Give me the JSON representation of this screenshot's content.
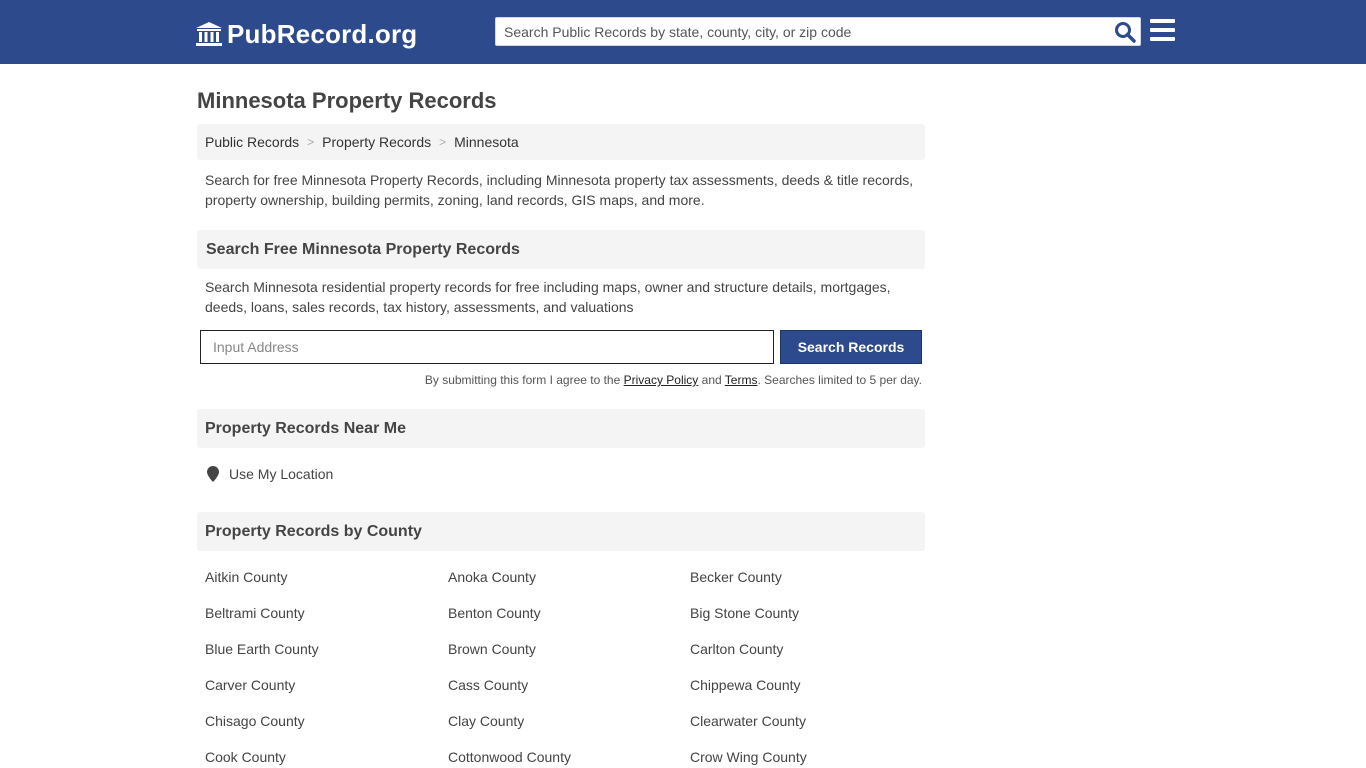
{
  "header": {
    "logo_text": "PubRecord.org",
    "search_placeholder": "Search Public Records by state, county, city, or zip code"
  },
  "page": {
    "title": "Minnesota Property Records",
    "breadcrumb": [
      "Public Records",
      "Property Records",
      "Minnesota"
    ],
    "intro": "Search for free Minnesota Property Records, including Minnesota property tax assessments, deeds & title records, property ownership, building permits, zoning, land records, GIS maps, and more."
  },
  "search_section": {
    "heading": "Search Free Minnesota Property Records",
    "description": "Search Minnesota residential property records for free including maps, owner and structure details, mortgages, deeds, loans, sales records, tax history, assessments, and valuations",
    "input_placeholder": "Input Address",
    "button_label": "Search Records",
    "disclaimer_prefix": "By submitting this form I agree to the ",
    "privacy_label": "Privacy Policy",
    "and_text": " and ",
    "terms_label": "Terms",
    "disclaimer_suffix": ". Searches limited to 5 per day."
  },
  "near_me": {
    "heading": "Property Records Near Me",
    "location_label": "Use My Location"
  },
  "by_county": {
    "heading": "Property Records by County",
    "counties": [
      "Aitkin County",
      "Anoka County",
      "Becker County",
      "Beltrami County",
      "Benton County",
      "Big Stone County",
      "Blue Earth County",
      "Brown County",
      "Carlton County",
      "Carver County",
      "Cass County",
      "Chippewa County",
      "Chisago County",
      "Clay County",
      "Clearwater County",
      "Cook County",
      "Cottonwood County",
      "Crow Wing County"
    ]
  },
  "colors": {
    "header_bg": "#2c4a8c",
    "panel_bg": "#f4f4f4"
  }
}
